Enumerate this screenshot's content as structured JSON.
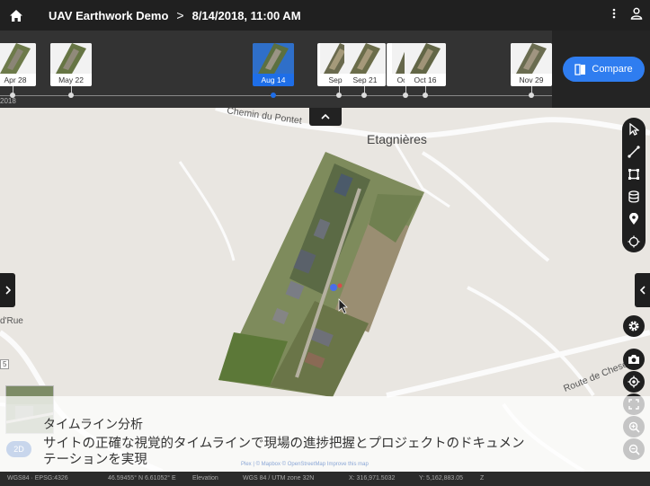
{
  "header": {
    "project_title": "UAV Earthwork Demo",
    "separator": ">",
    "date_time": "8/14/2018, 11:00 AM"
  },
  "timeline": {
    "year_label": "2018",
    "items": [
      {
        "label": "Apr 28"
      },
      {
        "label": "May 22"
      },
      {
        "label": "Aug 14",
        "selected": true
      },
      {
        "label": "Sep"
      },
      {
        "label": "Sep 21"
      },
      {
        "label": "Oc"
      },
      {
        "label": "Oct 16"
      },
      {
        "label": "Nov 29"
      }
    ],
    "compare_label": "Compare"
  },
  "map": {
    "labels": {
      "road1": "Chemin du Pontet",
      "town": "Etagnières",
      "road2": "Route de Cheseaux",
      "road_left": "d'Rue",
      "small_marker": "5"
    },
    "view_toggle": "2D"
  },
  "caption": {
    "title": "タイムライン分析",
    "body": "サイトの正確な視覚的タイムラインで現場の進捗把握とプロジェクトのドキュメンテーションを実現"
  },
  "attribution": "Plex | © Mapbox © OpenStreetMap Improve this map",
  "status": {
    "crs1": "WGS84 · EPSG:4326",
    "coords1": "46.59455° N 6.61052° E",
    "elevation": "Elevation",
    "crs2": "WGS 84 / UTM zone 32N",
    "x": "X: 316,971.5032",
    "y": "Y: 5,162,883.05",
    "z": "Z"
  },
  "colors": {
    "accent": "#2f7df0",
    "topbar": "#202020",
    "toolbar": "#1f1f1f"
  },
  "icons": [
    "home-icon",
    "more-vert-icon",
    "account-icon",
    "compare-icon",
    "chevron-up-icon",
    "chevron-left-icon",
    "chevron-right-icon",
    "select-arrow-icon",
    "line-measure-icon",
    "area-measure-icon",
    "volume-icon",
    "location-pin-icon",
    "crosshair-icon",
    "settings-gear-icon",
    "camera-icon",
    "locate-icon",
    "fullscreen-icon",
    "zoom-in-icon",
    "zoom-out-icon"
  ]
}
